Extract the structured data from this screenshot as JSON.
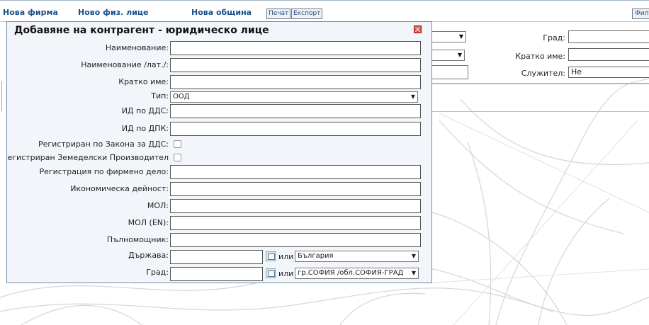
{
  "topbar": {
    "links": [
      "Нова фирма",
      "Ново физ. лице",
      "Нова община"
    ],
    "print_label": "Печат",
    "export_label": "Експорт",
    "filter_label": "Филт"
  },
  "background": {
    "city_label": "Град:",
    "short_name_label": "Кратко име:",
    "employee_label": "Служител:",
    "employee_value": "Не"
  },
  "dialog": {
    "title": "Добавяне на контрагент - юридическо лице",
    "fields": {
      "name": "Наименование:",
      "name_lat": "Наименование /лат./:",
      "short_name": "Кратко име:",
      "type": "Тип:",
      "type_value": "ООД",
      "vat_id": "ИД по ДДС:",
      "tax_id": "ИД по ДПК:",
      "vat_registered": "Регистриран по Закона за ДДС:",
      "farmer_registered": "Регистриран Земеделски Производител",
      "company_case": "Регистрация по фирмено дело:",
      "activity": "Икономическа дейност:",
      "mol": "МОЛ:",
      "mol_en": "МОЛ (EN):",
      "proxy": "Пълномощник:",
      "country": "Държава:",
      "country_or": "или",
      "country_value": "България",
      "city": "Град:",
      "city_or": "или",
      "city_value": "гр.СОФИЯ /обл.СОФИЯ-ГРАД"
    }
  }
}
